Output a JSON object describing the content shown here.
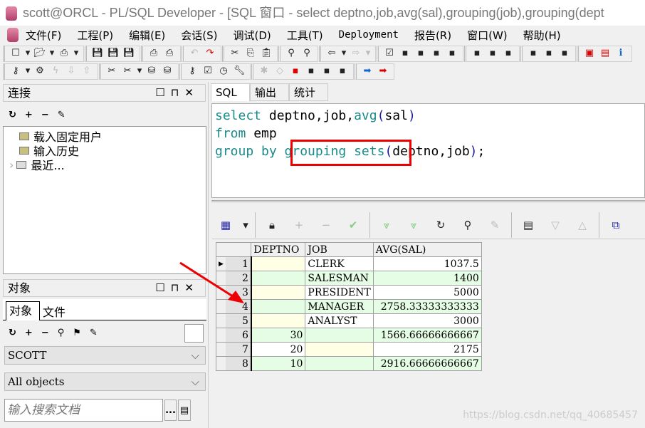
{
  "window": {
    "title": "scott@ORCL - PL/SQL Developer - [SQL 窗口 - select deptno,job,avg(sal),grouping(job),grouping(dept"
  },
  "menu": [
    "文件(F)",
    "工程(P)",
    "编辑(E)",
    "会话(S)",
    "调试(D)",
    "工具(T)",
    "Deployment",
    "报告(R)",
    "窗口(W)",
    "帮助(H)"
  ],
  "toolbar1": [
    [
      "new-icon",
      "new-dropdown-icon",
      "open-icon",
      "open-dropdown-icon",
      "print-template-icon",
      "template-dropdown-icon"
    ],
    [
      "save-icon",
      "save-as-icon",
      "save-all-icon"
    ],
    [
      "print-icon",
      "print-setup-icon"
    ],
    [
      "undo-icon",
      "redo-icon"
    ],
    [
      "cut-icon",
      "copy-icon",
      "paste-icon"
    ],
    [
      "find-icon",
      "find-next-icon"
    ],
    [
      "go-back-icon",
      "back-dropdown-icon",
      "go-forward-icon",
      "forward-dropdown-icon"
    ],
    [
      "check-icon",
      "indent-icon",
      "unindent-icon",
      "uppercase-icon",
      "lowercase-icon"
    ],
    [
      "debug-icon",
      "step-icon",
      "run-to-icon"
    ],
    [
      "cascade-icon",
      "tile-horizontal-icon",
      "tile-vertical-icon"
    ],
    [
      "oracle-icon",
      "pdf-icon",
      "info-icon"
    ]
  ],
  "toolbar2": [
    [
      "key-icon",
      "key-dropdown-icon",
      "settings-gear-icon",
      "lightning-icon",
      "import-icon",
      "export-icon"
    ],
    [
      "execute-icon",
      "sql-execute-icon",
      "sql-dropdown-icon",
      "commit-icon",
      "rollback-icon"
    ],
    [
      "explain-icon",
      "checklist-icon",
      "clock-icon",
      "wrench-icon"
    ],
    [
      "star-icon",
      "eraser-icon",
      "object-red-icon",
      "object-yellow-icon",
      "object-lock-icon",
      "object-edit-icon"
    ],
    [
      "arrow-blue-icon",
      "arrow-red-icon"
    ]
  ],
  "connection_panel": {
    "title": "连接",
    "tree": [
      "载入固定用户",
      "输入历史",
      "最近..."
    ]
  },
  "object_panel": {
    "title": "对象",
    "tabs": [
      "对象",
      "文件"
    ],
    "schema": "SCOTT",
    "filter": "All objects",
    "search_placeholder": "输入搜索文档",
    "browse_label": "..."
  },
  "sql_tabs": [
    "SQL",
    "输出",
    "统计"
  ],
  "sql": {
    "l1": [
      "select",
      "deptno,",
      "job,",
      "avg",
      "(",
      "sal",
      ")"
    ],
    "l2": [
      "from",
      "emp"
    ],
    "l3": [
      "group by",
      "grouping sets",
      "(",
      "deptno,",
      "job",
      ")",
      ";"
    ]
  },
  "grid": {
    "columns": [
      "DEPTNO",
      "JOB",
      "AVG(SAL)"
    ],
    "rows": [
      [
        "",
        "CLERK",
        "1037.5"
      ],
      [
        "",
        "SALESMAN",
        "1400"
      ],
      [
        "",
        "PRESIDENT",
        "5000"
      ],
      [
        "",
        "MANAGER",
        "2758.33333333333"
      ],
      [
        "",
        "ANALYST",
        "3000"
      ],
      [
        "30",
        "",
        "1566.66666666667"
      ],
      [
        "20",
        "",
        "2175"
      ],
      [
        "10",
        "",
        "2916.66666666667"
      ]
    ]
  },
  "colors": {
    "keyword": "#1a8a8a",
    "highlight_box": "#e00000",
    "null_cell": "#ffffe6",
    "alt_row": "#e4fde4",
    "arrow": "#e00000"
  },
  "watermark": "https://blog.csdn.net/qq_40685457"
}
